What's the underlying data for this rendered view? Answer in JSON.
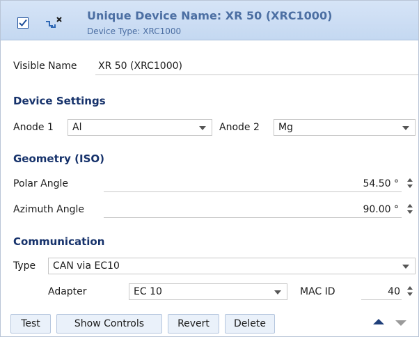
{
  "header": {
    "title": "Unique Device Name: XR 50 (XRC1000)",
    "subtitle": "Device Type: XRC1000",
    "checked": true
  },
  "visible_name": {
    "label": "Visible Name",
    "value": "XR 50 (XRC1000)"
  },
  "device_settings": {
    "heading": "Device Settings",
    "anode1": {
      "label": "Anode 1",
      "value": "Al"
    },
    "anode2": {
      "label": "Anode 2",
      "value": "Mg"
    }
  },
  "geometry": {
    "heading": "Geometry (ISO)",
    "polar": {
      "label": "Polar Angle",
      "value": "54.50 °"
    },
    "azimuth": {
      "label": "Azimuth Angle",
      "value": "90.00 °"
    }
  },
  "communication": {
    "heading": "Communication",
    "type": {
      "label": "Type",
      "value": "CAN via EC10"
    },
    "adapter": {
      "label": "Adapter",
      "value": "EC 10"
    },
    "mac": {
      "label": "MAC ID",
      "value": "40"
    }
  },
  "buttons": {
    "test": "Test",
    "show_controls": "Show Controls",
    "revert": "Revert",
    "delete": "Delete"
  },
  "colors": {
    "header_text": "#4c6fa3",
    "section_text": "#16326b",
    "header_bg": "#c4d8f1"
  }
}
